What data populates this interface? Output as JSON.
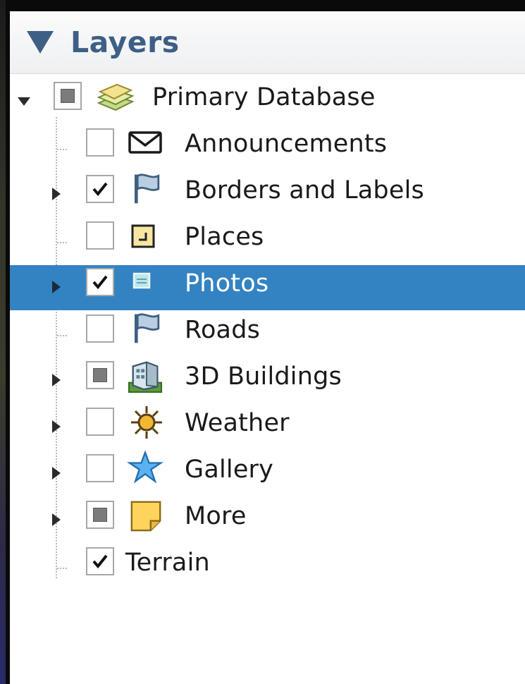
{
  "panel": {
    "title": "Layers"
  },
  "root": {
    "label": "Primary Database",
    "expanded": true,
    "check_state": "mixed"
  },
  "layers": [
    {
      "label": "Announcements",
      "check_state": "unchecked",
      "has_children": false,
      "selected": false,
      "icon": "envelope-icon"
    },
    {
      "label": "Borders and Labels",
      "check_state": "checked",
      "has_children": true,
      "selected": false,
      "icon": "flag-icon"
    },
    {
      "label": "Places",
      "check_state": "unchecked",
      "has_children": false,
      "selected": false,
      "icon": "places-icon"
    },
    {
      "label": "Photos",
      "check_state": "checked",
      "has_children": true,
      "selected": true,
      "icon": "photo-icon"
    },
    {
      "label": "Roads",
      "check_state": "unchecked",
      "has_children": false,
      "selected": false,
      "icon": "flag-icon"
    },
    {
      "label": "3D Buildings",
      "check_state": "mixed",
      "has_children": true,
      "selected": false,
      "icon": "building-icon"
    },
    {
      "label": "Weather",
      "check_state": "unchecked",
      "has_children": true,
      "selected": false,
      "icon": "sun-icon"
    },
    {
      "label": "Gallery",
      "check_state": "unchecked",
      "has_children": true,
      "selected": false,
      "icon": "star-icon"
    },
    {
      "label": "More",
      "check_state": "mixed",
      "has_children": true,
      "selected": false,
      "icon": "note-icon"
    },
    {
      "label": "Terrain",
      "check_state": "checked",
      "has_children": false,
      "selected": false,
      "icon": ""
    }
  ],
  "colors": {
    "header_title": "#3d5f86",
    "selection": "#3383c3",
    "checkbox_border": "#a7a7a7"
  }
}
